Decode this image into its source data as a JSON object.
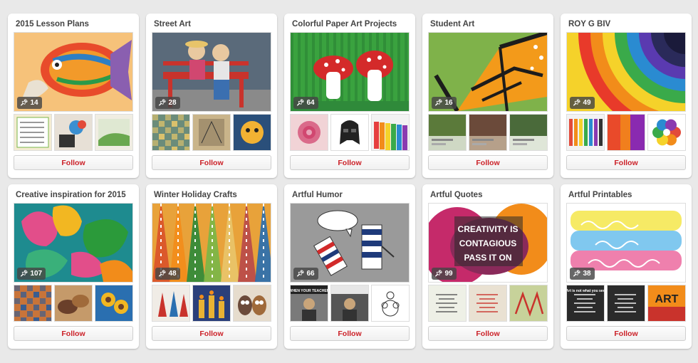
{
  "boards": [
    {
      "title": "2015 Lesson Plans",
      "pins": "14",
      "follow": "Follow",
      "cover_icon": "tropical-fish-clay-sculpture",
      "cover_colors": [
        "#f6c27a",
        "#e84b2b",
        "#2d7fc4",
        "#8a5fb0"
      ],
      "thumbs": [
        {
          "icon": "lesson-sign",
          "colors": [
            "#f4ecd2",
            "#7ab648"
          ]
        },
        {
          "icon": "craft-flower",
          "colors": [
            "#e7e0d6",
            "#3a8fd1"
          ]
        },
        {
          "icon": "landscape-sketch",
          "colors": [
            "#f0ede2",
            "#6aa84f"
          ]
        }
      ]
    },
    {
      "title": "Street Art",
      "pins": "28",
      "follow": "Follow",
      "cover_icon": "mural-couple-on-bench",
      "cover_colors": [
        "#5a6a7a",
        "#c9332c",
        "#3b6fb0",
        "#e9c9a0"
      ],
      "thumbs": [
        {
          "icon": "mosaic-pattern",
          "colors": [
            "#6b8c7a",
            "#e7c76a"
          ]
        },
        {
          "icon": "chalk-drawing",
          "colors": [
            "#c9b48a",
            "#6f5c45"
          ]
        },
        {
          "icon": "mural-face",
          "colors": [
            "#2a4f7a",
            "#f2b233"
          ]
        }
      ]
    },
    {
      "title": "Colorful Paper Art Projects",
      "pins": "64",
      "follow": "Follow",
      "cover_icon": "paper-mushrooms",
      "cover_colors": [
        "#3aa23f",
        "#d42a2a",
        "#ffffff",
        "#1f6e2a"
      ],
      "thumbs": [
        {
          "icon": "paper-rose",
          "colors": [
            "#f1d3d6",
            "#d14770"
          ]
        },
        {
          "icon": "darth-vader-mask",
          "colors": [
            "#ffffff",
            "#222222"
          ]
        },
        {
          "icon": "rainbow-paper-strips",
          "colors": [
            "#f2f2f2",
            "#e63e3e"
          ]
        }
      ]
    },
    {
      "title": "Student Art",
      "pins": "16",
      "follow": "Follow",
      "cover_icon": "monarch-butterfly",
      "cover_colors": [
        "#7fb24a",
        "#f39a1a",
        "#1c1c1c",
        "#d45a1a"
      ],
      "thumbs": [
        {
          "icon": "gallery-photo",
          "colors": [
            "#cfd8c4",
            "#5b7a3a"
          ]
        },
        {
          "icon": "gallery-photo",
          "colors": [
            "#b6a08a",
            "#6b4a3a"
          ]
        },
        {
          "icon": "gallery-photo",
          "colors": [
            "#dfe6d8",
            "#4a6a3a"
          ]
        }
      ]
    },
    {
      "title": "ROY G BIV",
      "pins": "49",
      "follow": "Follow",
      "cover_icon": "rainbow-dot-mandala",
      "cover_colors": [
        "#f5d22a",
        "#e8561f",
        "#2a8bd1",
        "#3aaa4a"
      ],
      "thumbs": [
        {
          "icon": "color-pencils",
          "colors": [
            "#f2f2f2",
            "#e24a3a"
          ]
        },
        {
          "icon": "ink-blend",
          "colors": [
            "#e94a2a",
            "#8a2ab0"
          ]
        },
        {
          "icon": "color-wheel",
          "colors": [
            "#ffffff",
            "#2a8bd1"
          ]
        }
      ]
    },
    {
      "title": "Creative inspiration for 2015",
      "pins": "107",
      "follow": "Follow",
      "cover_icon": "tropical-leaves-painting",
      "cover_colors": [
        "#1e8b8f",
        "#e24e8a",
        "#f2b722",
        "#2b9a3a"
      ],
      "thumbs": [
        {
          "icon": "mosaic-tiles",
          "colors": [
            "#c8743a",
            "#2a5b9a"
          ]
        },
        {
          "icon": "clay-bowls",
          "colors": [
            "#c59a6a",
            "#6a3f2a"
          ]
        },
        {
          "icon": "sunflowers",
          "colors": [
            "#f2b722",
            "#2a6fb0"
          ]
        }
      ]
    },
    {
      "title": "Winter Holiday Crafts",
      "pins": "48",
      "follow": "Follow",
      "cover_icon": "patterned-trees",
      "cover_colors": [
        "#e8a23a",
        "#2f8a3a",
        "#b94a4a",
        "#f0e6d8"
      ],
      "thumbs": [
        {
          "icon": "gnome-crafts",
          "colors": [
            "#f0ece6",
            "#c9332c"
          ]
        },
        {
          "icon": "candle-painting",
          "colors": [
            "#2a3f7a",
            "#e9b233"
          ]
        },
        {
          "icon": "owl-ornaments",
          "colors": [
            "#e6dccd",
            "#6b4a3a"
          ]
        }
      ]
    },
    {
      "title": "Artful Humor",
      "pins": "66",
      "follow": "Follow",
      "cover_icon": "comic-paint-tubes",
      "cover_colors": [
        "#9a9a9a",
        "#1e3a7a",
        "#d22a2a",
        "#ffffff"
      ],
      "thumbs": [
        {
          "icon": "meme-photo",
          "colors": [
            "#222222",
            "#7a7a7a"
          ],
          "caption": "WHEN YOUR TEACHER"
        },
        {
          "icon": "meme-photo",
          "colors": [
            "#e6e6e6",
            "#555555"
          ]
        },
        {
          "icon": "line-drawing",
          "colors": [
            "#ffffff",
            "#333333"
          ]
        }
      ]
    },
    {
      "title": "Artful Quotes",
      "pins": "99",
      "follow": "Follow",
      "cover_icon": "paint-splash-quote",
      "cover_colors": [
        "#c52a6a",
        "#f28c1a",
        "#2a2a2a",
        "#ffffff"
      ],
      "cover_text": [
        "CREATIVITY IS",
        "CONTAGIOUS",
        "PASS IT ON"
      ],
      "thumbs": [
        {
          "icon": "quote-card",
          "colors": [
            "#eef0e6",
            "#555555"
          ]
        },
        {
          "icon": "quote-card",
          "colors": [
            "#e9e1d2",
            "#c9332c"
          ]
        },
        {
          "icon": "lettering-art",
          "colors": [
            "#c7d29a",
            "#c9332c"
          ]
        }
      ]
    },
    {
      "title": "Artful Printables",
      "pins": "38",
      "follow": "Follow",
      "cover_icon": "watercolor-lettering",
      "cover_colors": [
        "#f5e64a",
        "#4ab0e8",
        "#e84a8a",
        "#ffffff"
      ],
      "thumbs": [
        {
          "icon": "quote-card",
          "colors": [
            "#2a2a2a",
            "#ffffff"
          ],
          "caption": "Art is not what you see"
        },
        {
          "icon": "quote-card",
          "colors": [
            "#2b2b2b",
            "#ffffff"
          ]
        },
        {
          "icon": "bold-art-poster",
          "colors": [
            "#f28c1a",
            "#c9332c"
          ],
          "caption": "ART"
        }
      ]
    }
  ]
}
